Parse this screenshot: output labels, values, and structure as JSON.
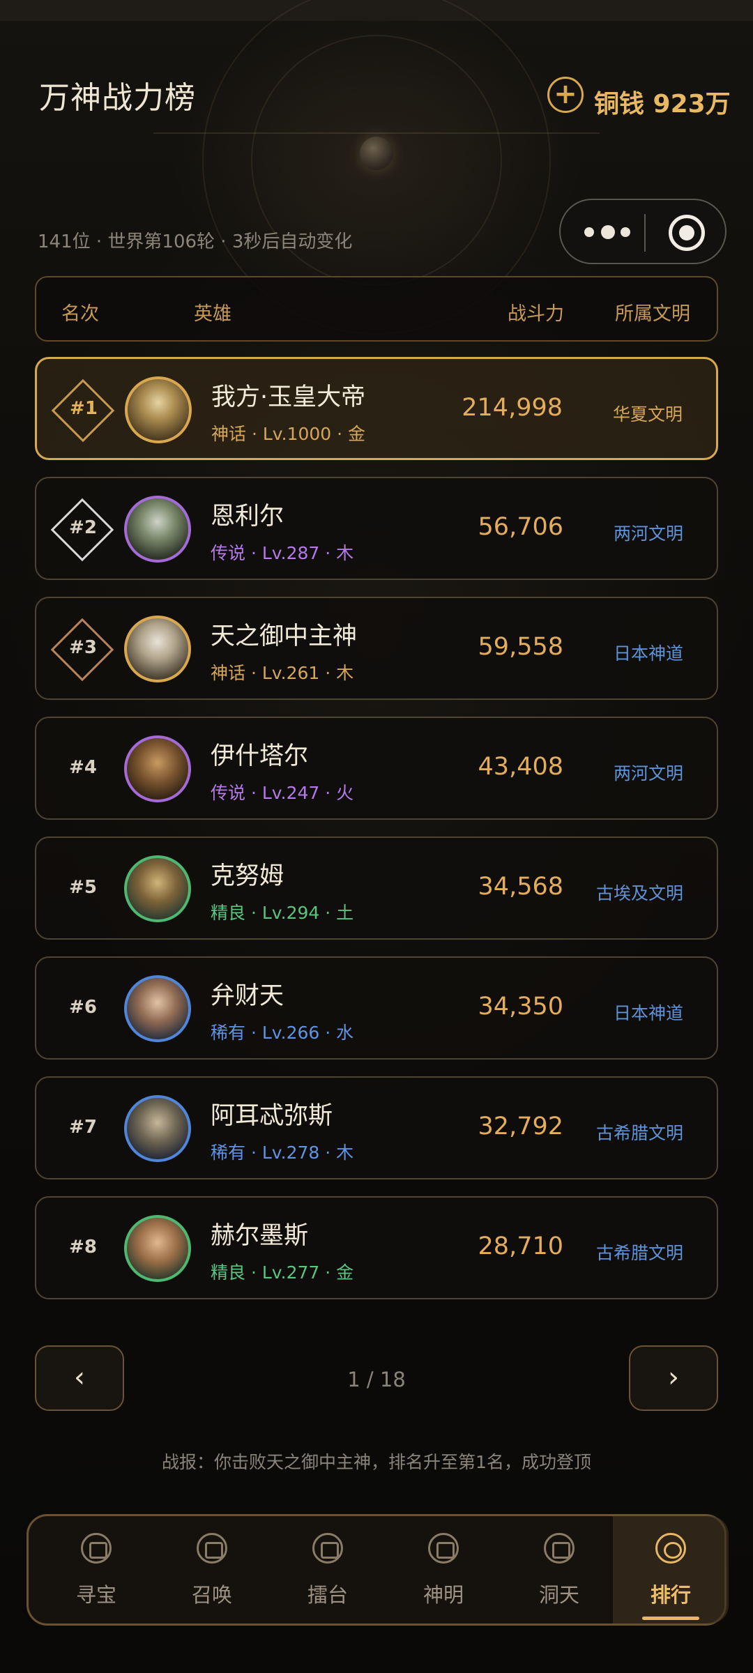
{
  "header": {
    "title": "万神战力榜",
    "coin_plus_icon": "+",
    "coin_text": "铜钱 923万",
    "subinfo": "141位 · 世界第106轮 · 3秒后自动变化"
  },
  "table_header": {
    "rank": "名次",
    "hero": "英雄",
    "power": "战斗力",
    "civ": "所属文明"
  },
  "rows": [
    {
      "rank": "#1",
      "name": "我方·玉皇大帝",
      "meta": "神话 · Lv.1000 · 金",
      "power": "214,998",
      "civ": "华夏文明"
    },
    {
      "rank": "#2",
      "name": "恩利尔",
      "meta": "传说 · Lv.287 · 木",
      "power": "56,706",
      "civ": "两河文明"
    },
    {
      "rank": "#3",
      "name": "天之御中主神",
      "meta": "神话 · Lv.261 · 木",
      "power": "59,558",
      "civ": "日本神道"
    },
    {
      "rank": "#4",
      "name": "伊什塔尔",
      "meta": "传说 · Lv.247 · 火",
      "power": "43,408",
      "civ": "两河文明"
    },
    {
      "rank": "#5",
      "name": "克努姆",
      "meta": "精良 · Lv.294 · 土",
      "power": "34,568",
      "civ": "古埃及文明"
    },
    {
      "rank": "#6",
      "name": "弁财天",
      "meta": "稀有 · Lv.266 · 水",
      "power": "34,350",
      "civ": "日本神道"
    },
    {
      "rank": "#7",
      "name": "阿耳忒弥斯",
      "meta": "稀有 · Lv.278 · 木",
      "power": "32,792",
      "civ": "古希腊文明"
    },
    {
      "rank": "#8",
      "name": "赫尔墨斯",
      "meta": "精良 · Lv.277 · 金",
      "power": "28,710",
      "civ": "古希腊文明"
    }
  ],
  "pagination": {
    "prev": "‹",
    "next": "›",
    "page": "1 / 18"
  },
  "report": "战报：你击败天之御中主神，排名升至第1名，成功登顶",
  "tabs": [
    "寻宝",
    "召唤",
    "擂台",
    "神明",
    "洞天",
    "排行"
  ],
  "colors": {
    "accent_gold": "#d8a74e",
    "rarity_mythic": "#d6a759",
    "rarity_legend": "#b47ae6",
    "rarity_fine": "#5cc380",
    "rarity_rare": "#5f93e4",
    "civ_text": "#5f93d8"
  }
}
